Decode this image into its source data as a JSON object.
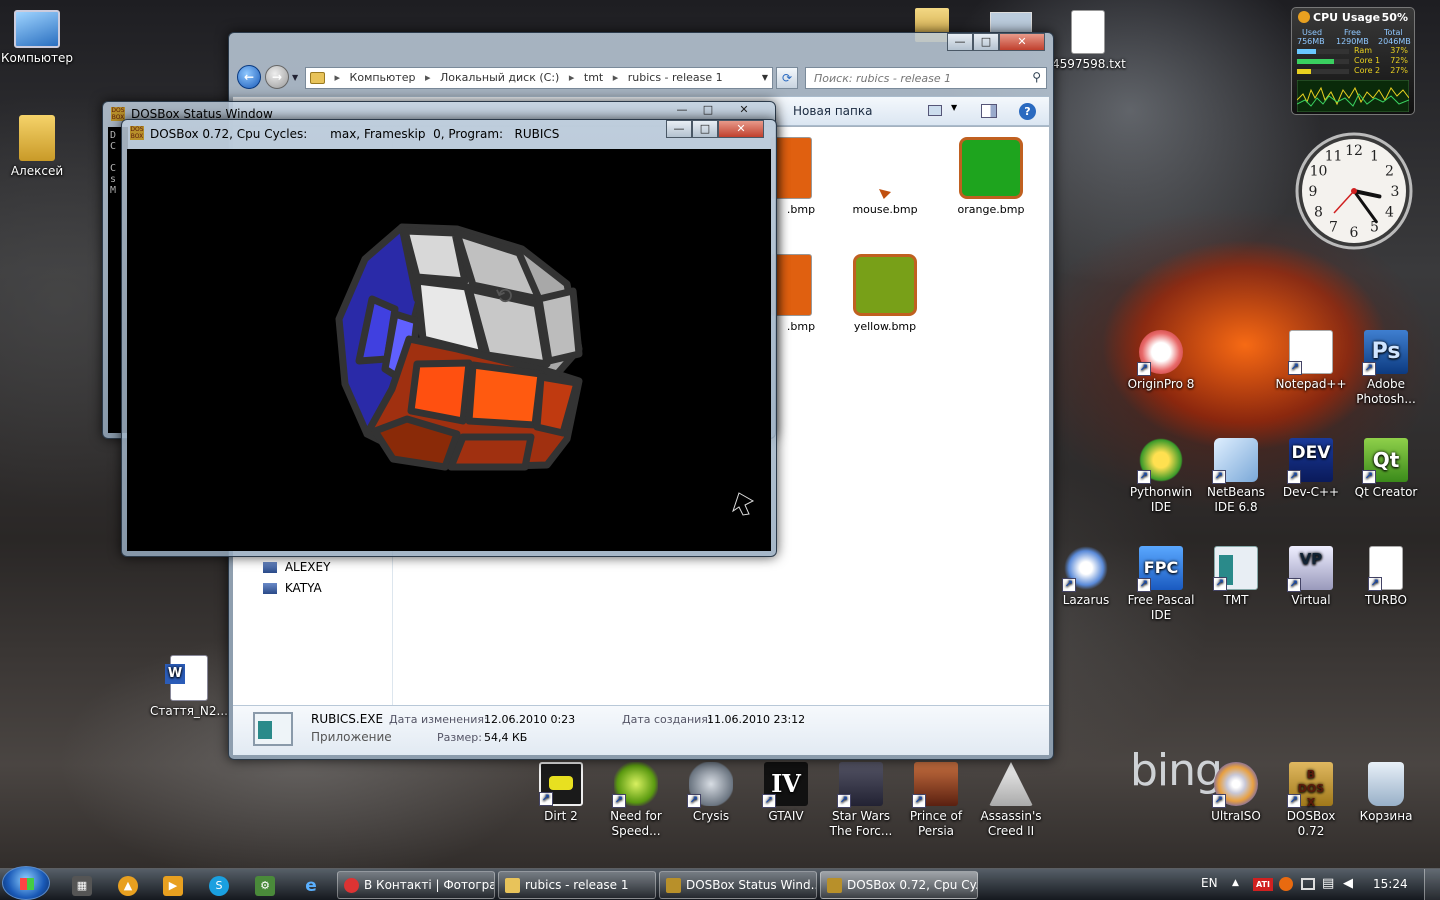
{
  "desktop_icons": {
    "computer": "Компьютер",
    "user": "Алексей",
    "word_doc": "Стаття_N2...",
    "txt_file": "4597598.txt",
    "originpro": "OriginPro 8",
    "notepadpp": "Notepad++",
    "photoshop": "Adobe Photosh...",
    "pythonwin": "Pythonwin IDE",
    "netbeans": "NetBeans IDE 6.8",
    "devcpp": "Dev-C++",
    "qt": "Qt Creator",
    "lazarus": "Lazarus",
    "fpc": "Free Pascal IDE",
    "tmt": "TMT",
    "virtual": "Virtual",
    "turbo": "TURBO",
    "dirt2": "Dirt 2",
    "nfs": "Need for Speed...",
    "crysis": "Crysis",
    "gtaiv": "GTAIV",
    "starwars": "Star Wars The Forc...",
    "prince": "Prince of Persia",
    "assassins": "Assassin's Creed II",
    "ultraiso": "UltraISO",
    "dosbox": "DOSBox 0.72",
    "recycle": "Корзина",
    "bing": "bing"
  },
  "gadget_cpu": {
    "title": "CPU Usage",
    "percent": "50%",
    "h_used": "Used",
    "h_free": "Free",
    "h_total": "Total",
    "used": "756MB",
    "free": "1290MB",
    "total": "2046MB",
    "ram_label": "Ram",
    "ram_val": "37%",
    "ram_fill": 0.37,
    "core1_label": "Core 1",
    "core1_val": "72%",
    "core1_fill": 0.72,
    "core2_label": "Core 2",
    "core2_val": "27%",
    "core2_fill": 0.27
  },
  "clock_gadget": {
    "numbers": [
      "12",
      "1",
      "2",
      "3",
      "4",
      "5",
      "6",
      "7",
      "8",
      "9",
      "10",
      "11"
    ],
    "hour": 3,
    "minute": 24
  },
  "explorer": {
    "breadcrumb": [
      "Компьютер",
      "Локальный диск (C:)",
      "tmt",
      "rubics - release 1"
    ],
    "search_placeholder": "Поиск: rubics - release 1",
    "new_folder": "Новая папка",
    "files": [
      {
        "name": ".bmp",
        "color": "#e06010"
      },
      {
        "name": "mouse.bmp",
        "color": "#c05010"
      },
      {
        "name": "orange.bmp",
        "color": "#1ea41e"
      },
      {
        "name": ".bmp",
        "color": "#e06010"
      },
      {
        "name": "yellow.bmp",
        "color": "#78a018"
      }
    ],
    "nav_items": [
      "ALEXEY",
      "KATYA"
    ],
    "details": {
      "name": "RUBICS.EXE",
      "type": "Приложение",
      "modified_label": "Дата изменения:",
      "modified": "12.06.2010 0:23",
      "created_label": "Дата создания:",
      "created": "11.06.2010 23:12",
      "size_label": "Размер:",
      "size": "54,4 КБ"
    }
  },
  "status_window": {
    "title": "DOSBox Status Window",
    "side_text": "D\nC\n\nC\ns\nM"
  },
  "dosbox_window": {
    "title": "DOSBox 0.72, Cpu Cycles:      max, Frameskip  0, Program:   RUBICS"
  },
  "taskbar": {
    "tasks": [
      {
        "label": "В Контакті | Фотогра...",
        "color": "#d33"
      },
      {
        "label": "rubics - release 1",
        "color": "#e8c35a"
      },
      {
        "label": "DOSBox Status Wind...",
        "color": "#b8902a"
      },
      {
        "label": "DOSBox 0.72, Cpu Cy...",
        "color": "#b8902a"
      }
    ],
    "lang": "EN",
    "time": "15:24"
  }
}
